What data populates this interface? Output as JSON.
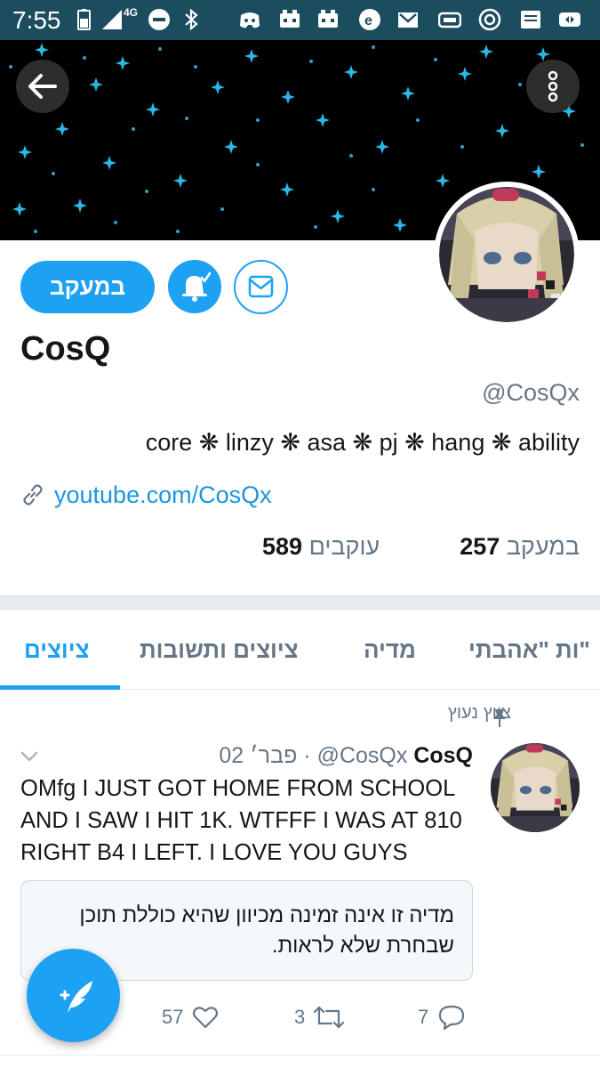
{
  "status_bar": {
    "time": "7:55",
    "network": "4G",
    "icons": [
      "battery-icon",
      "signal-icon",
      "dnd-icon",
      "bluetooth-icon",
      "discord-icon",
      "game-icon",
      "game-icon",
      "browser-icon",
      "gmail-icon",
      "screen-icon",
      "vpn-icon",
      "message-icon",
      "notification-icon"
    ]
  },
  "profile": {
    "follow_label": "במעקב",
    "display_name": "CosQ",
    "handle": "@CosQx",
    "bio": "core ❋ linzy ❋ asa ❋ pj ❋ hang ❋ ability",
    "link": "youtube.com/CosQx",
    "following_count": "257",
    "following_label": "במעקב",
    "followers_count": "589",
    "followers_label": "עוקבים"
  },
  "tabs": [
    {
      "label": "ציוצים",
      "active": true
    },
    {
      "label": "ציוצים ותשובות",
      "active": false
    },
    {
      "label": "מדיה",
      "active": false
    },
    {
      "label": "ות \"אהבתי\"",
      "active": false
    }
  ],
  "tweet": {
    "pinned_label": "ציוץ נעוץ",
    "name": "CosQ",
    "handle": "@CosQx",
    "date": "02 פבר׳",
    "separator": "·",
    "text": "OMfg I JUST GOT HOME FROM SCHOOL AND I SAW I HIT 1K. WTFFF I WAS AT 810 RIGHT B4 I LEFT. I LOVE YOU GUYS",
    "sensitive_notice": "מדיה זו אינה זמינה מכיוון שהיא כוללת תוכן שבחרת שלא לראות.",
    "likes": "57",
    "retweets": "3",
    "replies": "7"
  },
  "colors": {
    "accent": "#1da1f2",
    "status_bar": "#1c4d5f",
    "muted_text": "#657786",
    "link": "#1b95e0"
  }
}
